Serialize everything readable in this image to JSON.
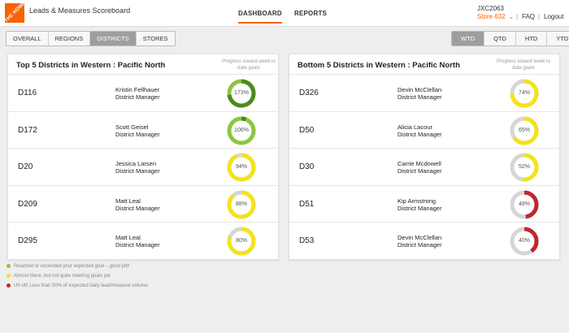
{
  "header": {
    "logo_text": "THE HOME DEPOT",
    "app_title": "Leads & Measures Scoreboard",
    "nav": [
      "DASHBOARD",
      "REPORTS"
    ],
    "user_id": "JXC2063",
    "store": "Store 632",
    "faq": "FAQ",
    "logout": "Logout",
    "separator": "|"
  },
  "view_tabs": {
    "items": [
      "OVERALL",
      "REGIONS",
      "DISTRICTS",
      "STORES"
    ],
    "selected": "DISTRICTS"
  },
  "period_tabs": {
    "items": [
      "WTD",
      "QTD",
      "HTD",
      "YTD"
    ],
    "selected": "WTD"
  },
  "progress_header": "Progress toward week to date goals",
  "top_card": {
    "title": "Top 5 Districts in Western : Pacific North",
    "rows": [
      {
        "code": "D116",
        "name": "Kristin Fellhauer",
        "role": "District Manager",
        "progress": 1.73,
        "label": "173%",
        "status": "green"
      },
      {
        "code": "D172",
        "name": "Scott Geisel",
        "role": "District Manager",
        "progress": 1.06,
        "label": "106%",
        "status": "green"
      },
      {
        "code": "D20",
        "name": "Jessica Larsen",
        "role": "District Manager",
        "progress": 0.94,
        "label": "94%",
        "status": "yellow"
      },
      {
        "code": "D209",
        "name": "Matt Leal",
        "role": "District Manager",
        "progress": 0.88,
        "label": "88%",
        "status": "yellow"
      },
      {
        "code": "D295",
        "name": "Matt Leal",
        "role": "District Manager",
        "progress": 0.8,
        "label": "80%",
        "status": "yellow"
      }
    ]
  },
  "bottom_card": {
    "title": "Bottom 5 Districts in Western : Pacific North",
    "rows": [
      {
        "code": "D326",
        "name": "Devin McClellan",
        "role": "District Manager",
        "progress": 0.74,
        "label": "74%",
        "status": "yellow"
      },
      {
        "code": "D50",
        "name": "Alicia Lacour",
        "role": "District Manager",
        "progress": 0.65,
        "label": "65%",
        "status": "yellow"
      },
      {
        "code": "D30",
        "name": "Carrie Mcdowell",
        "role": "District Manager",
        "progress": 0.52,
        "label": "52%",
        "status": "yellow"
      },
      {
        "code": "D51",
        "name": "Kip Armstrong",
        "role": "District Manager",
        "progress": 0.48,
        "label": "48%",
        "status": "red"
      },
      {
        "code": "D53",
        "name": "Devin McClellan",
        "role": "District Manager",
        "progress": 0.4,
        "label": "40%",
        "status": "red"
      }
    ]
  },
  "legend": [
    {
      "color": "#8cc63f",
      "text": "Reached or exceeded your expected goal – good job!"
    },
    {
      "color": "#f5e11b",
      "text": "Almost there, but not quite meeting goals yet"
    },
    {
      "color": "#c1272d",
      "text": "Uh oh! Less than 50% of expected daily lead/measure volume."
    }
  ],
  "colors": {
    "accent": "#f96302",
    "green": "#8cc63f",
    "green_dark": "#4a8a1c",
    "yellow": "#f5e11b",
    "red": "#c1272d",
    "track": "#d6d6d6"
  }
}
